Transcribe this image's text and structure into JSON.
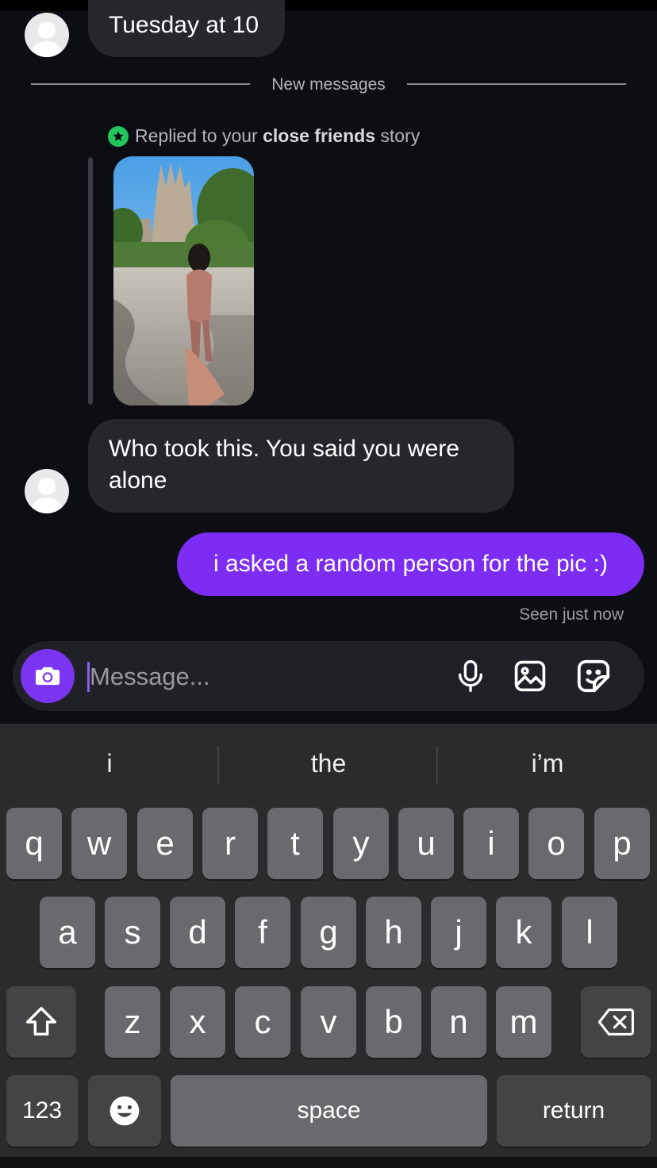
{
  "thread": {
    "timestamp_bubble": "Tuesday at 10",
    "new_messages_label": "New messages",
    "reply_context": {
      "prefix": "Replied to your",
      "emphasis": "close friends",
      "suffix": "story"
    },
    "incoming_message": "Who took this. You said you were alone",
    "outgoing_message": "i asked a random person for the pic :)",
    "seen_status": "Seen just now"
  },
  "composer": {
    "placeholder": "Message...",
    "icons": [
      "camera-icon",
      "microphone-icon",
      "gallery-icon",
      "sticker-icon"
    ],
    "accent_color": "#7d2cf3"
  },
  "keyboard": {
    "suggestions": [
      "i",
      "the",
      "i’m"
    ],
    "row1": [
      "q",
      "w",
      "e",
      "r",
      "t",
      "y",
      "u",
      "i",
      "o",
      "p"
    ],
    "row2": [
      "a",
      "s",
      "d",
      "f",
      "g",
      "h",
      "j",
      "k",
      "l"
    ],
    "row3": [
      "z",
      "x",
      "c",
      "v",
      "b",
      "n",
      "m"
    ],
    "numbers_label": "123",
    "space_label": "space",
    "return_label": "return"
  }
}
